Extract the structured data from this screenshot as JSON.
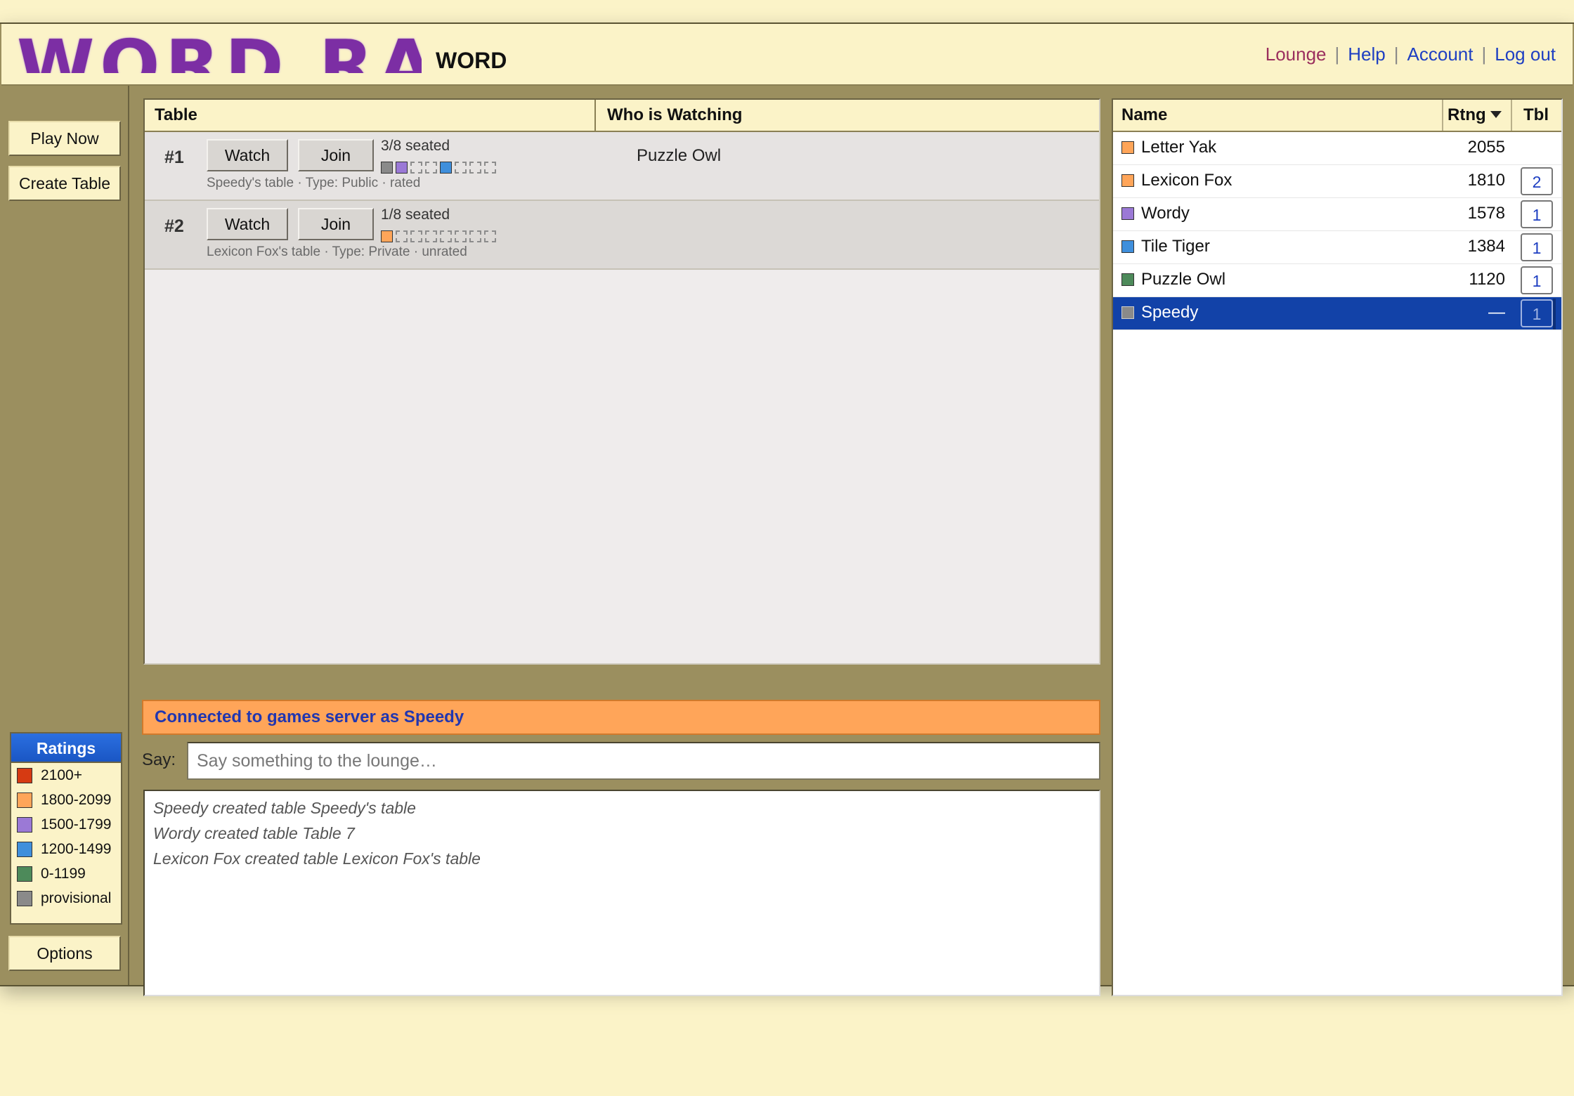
{
  "header": {
    "logo_text": "WORD RACER",
    "subtitle": "WORD",
    "nav": [
      {
        "label": "Lounge",
        "active": true
      },
      {
        "label": "Help"
      },
      {
        "label": "Account"
      },
      {
        "label": "Log out"
      }
    ],
    "separator": "|"
  },
  "sidebar": {
    "play_now": "Play Now",
    "create_table": "Create Table",
    "options": "Options",
    "ratings": {
      "title": "Ratings",
      "items": [
        {
          "label": "2100+",
          "color": "#d63a12"
        },
        {
          "label": "1800-2099",
          "color": "#ffa559"
        },
        {
          "label": "1500-1799",
          "color": "#9b79d6"
        },
        {
          "label": "1200-1499",
          "color": "#3f8fdc"
        },
        {
          "label": "0-1199",
          "color": "#4d8a5a"
        },
        {
          "label": "provisional",
          "color": "#8a8a8a"
        }
      ]
    }
  },
  "tables": {
    "headers": {
      "table": "Table",
      "watching": "Who is Watching"
    },
    "watch_label": "Watch",
    "join_label": "Join",
    "rows": [
      {
        "num": "#1",
        "seated": "3/8 seated",
        "seats": [
          "#8a8a8a",
          "#9b79d6",
          "empty",
          "empty",
          "#3f8fdc",
          "empty",
          "empty",
          "empty"
        ],
        "desc": "Speedy's table · Type: Public · rated",
        "watchers": "Puzzle Owl"
      },
      {
        "num": "#2",
        "seated": "1/8 seated",
        "seats": [
          "#ffa559",
          "empty",
          "empty",
          "empty",
          "empty",
          "empty",
          "empty",
          "empty"
        ],
        "desc": "Lexicon Fox's table · Type: Private · unrated",
        "watchers": ""
      }
    ]
  },
  "status": "Connected to games server as Speedy",
  "chat": {
    "say_label": "Say:",
    "placeholder": "Say something to the lounge…",
    "log": [
      "Speedy created table Speedy's table",
      "Wordy created table Table 7",
      "Lexicon Fox created table Lexicon Fox's table"
    ]
  },
  "players": {
    "headers": {
      "name": "Name",
      "rating": "Rtng",
      "table": "Tbl"
    },
    "rows": [
      {
        "name": "Letter Yak",
        "rating": "2055",
        "table": "",
        "color": "#ffa559"
      },
      {
        "name": "Lexicon Fox",
        "rating": "1810",
        "table": "2",
        "color": "#ffa559"
      },
      {
        "name": "Wordy",
        "rating": "1578",
        "table": "1",
        "color": "#9b79d6"
      },
      {
        "name": "Tile Tiger",
        "rating": "1384",
        "table": "1",
        "color": "#3f8fdc"
      },
      {
        "name": "Puzzle Owl",
        "rating": "1120",
        "table": "1",
        "color": "#4d8a5a"
      },
      {
        "name": "Speedy",
        "rating": "—",
        "table": "1",
        "color": "#8a8a8a",
        "selected": true
      }
    ]
  }
}
